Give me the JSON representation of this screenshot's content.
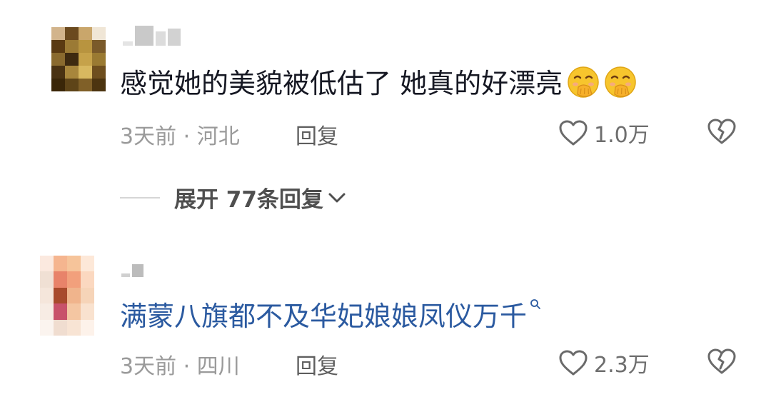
{
  "comments": [
    {
      "text": "感觉她的美貌被低估了  她真的好漂亮",
      "emojis": [
        "blush-hand-over-mouth-emoji",
        "blush-hand-over-mouth-emoji"
      ],
      "time": "3天前",
      "separator": "·",
      "location": "河北",
      "reply_label": "回复",
      "like_count": "1.0万",
      "expand_label": "展开 77条回复"
    },
    {
      "text": "满蒙八旗都不及华妃娘娘凤仪万千",
      "time": "3天前",
      "separator": "·",
      "location": "四川",
      "reply_label": "回复",
      "like_count": "2.3万"
    }
  ],
  "colors": {
    "link_text": "#2b5aa0",
    "body_text": "#161823",
    "meta_text": "#9a9a9a"
  },
  "icons": [
    "heart-outline-icon",
    "broken-heart-icon",
    "chevron-down-icon",
    "search-icon"
  ]
}
